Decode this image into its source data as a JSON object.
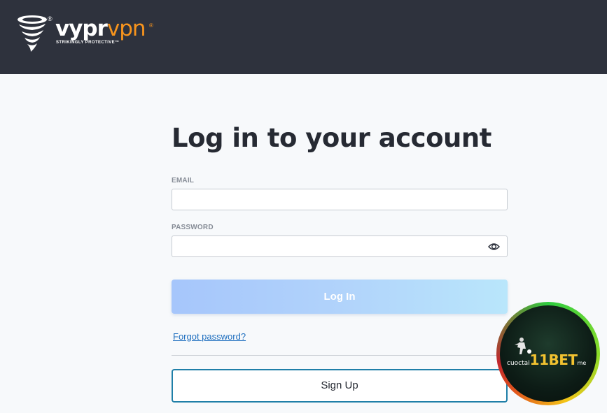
{
  "header": {
    "brand_primary": "vypr",
    "brand_secondary": "vpn",
    "tagline": "STRIKINGLY PROTECTIVE™",
    "registered_mark": "®",
    "brand_accent_color": "#f7941d",
    "background_color": "#2e323d"
  },
  "login": {
    "title": "Log in to your account",
    "email_label": "EMAIL",
    "email_value": "",
    "password_label": "PASSWORD",
    "password_value": "",
    "show_password_icon": "eye-icon",
    "login_button": "Log In",
    "forgot_link": "Forgot password?",
    "signup_button": "Sign Up"
  },
  "overlay_badge": {
    "prefix": "cuoctai",
    "main": "11BET",
    "suffix": "me"
  }
}
